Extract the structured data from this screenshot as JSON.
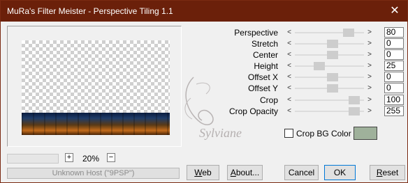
{
  "window": {
    "title": "MuRa's Filter Meister - Perspective Tiling 1.1",
    "close_glyph": "✕"
  },
  "preview": {
    "zoom_out_glyph": "+",
    "zoom_level": "20%",
    "zoom_in_glyph": "−"
  },
  "status": "Unknown Host (\"9PSP\")",
  "params": [
    {
      "label": "Perspective",
      "value": "80",
      "thumb_fraction": 0.83
    },
    {
      "label": "Stretch",
      "value": "0",
      "thumb_fraction": 0.55
    },
    {
      "label": "Center",
      "value": "0",
      "thumb_fraction": 0.55
    },
    {
      "label": "Height",
      "value": "25",
      "thumb_fraction": 0.32
    },
    {
      "label": "Offset X",
      "value": "0",
      "thumb_fraction": 0.55
    },
    {
      "label": "Offset Y",
      "value": "0",
      "thumb_fraction": 0.55
    },
    {
      "label": "Crop",
      "value": "100",
      "thumb_fraction": 0.93
    },
    {
      "label": "Crop Opacity",
      "value": "255",
      "thumb_fraction": 0.93
    }
  ],
  "crop_bg": {
    "label": "Crop BG Color",
    "checked": false,
    "color": "#9fb19b"
  },
  "buttons": {
    "web": {
      "prefix": "",
      "accel": "W",
      "rest": "eb"
    },
    "about": {
      "prefix": "",
      "accel": "A",
      "rest": "bout..."
    },
    "cancel": "Cancel",
    "ok": "OK",
    "reset": {
      "prefix": "",
      "accel": "R",
      "rest": "eset"
    }
  },
  "watermark": "Sylviane"
}
